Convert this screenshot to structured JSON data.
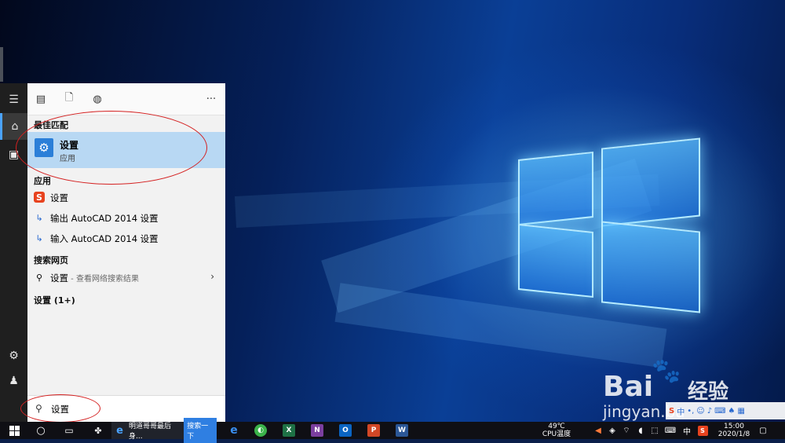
{
  "start_panel": {
    "section_best": "最佳匹配",
    "best_match": {
      "title": "设置",
      "subtitle": "应用"
    },
    "section_apps": "应用",
    "apps": [
      {
        "label": "设置"
      },
      {
        "label": "输出 AutoCAD 2014 设置"
      },
      {
        "label": "输入 AutoCAD 2014 设置"
      }
    ],
    "section_web": "搜索网页",
    "web_result": {
      "label": "设置",
      "hint": " - 查看网络搜索结果"
    },
    "section_settings": "设置 (1+)",
    "search_value": "设置",
    "more_label": "···"
  },
  "taskbar": {
    "ie_title": "明道哥哥最后身...",
    "ie_search_button": "搜索一下",
    "temperature": "49℃",
    "temp_label": "CPU温度",
    "ime": "中",
    "time": "15:00",
    "date": "2020/1/8"
  },
  "watermark": {
    "logo": "Bai",
    "logo2": "经验",
    "url": "jingyan.ba"
  },
  "colors": {
    "accent": "#2b7fd8",
    "highlight": "#b8d8f3",
    "annotation": "#d42020"
  },
  "icons": [
    "hamburger-icon",
    "home-icon",
    "document-icon",
    "gear-icon",
    "user-icon",
    "list-icon",
    "file-icon",
    "globe-icon",
    "search-icon",
    "windows-icon",
    "cortana-icon",
    "task-view-icon"
  ]
}
